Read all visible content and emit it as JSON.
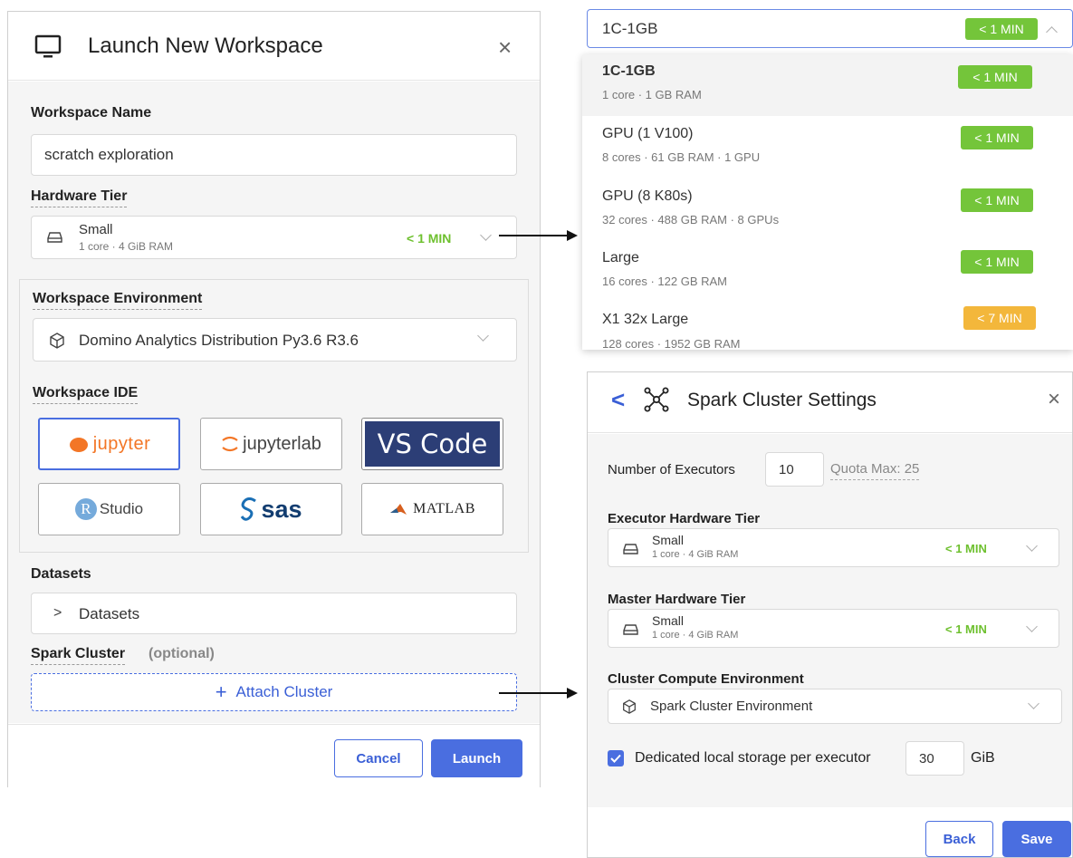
{
  "launch": {
    "title": "Launch New Workspace",
    "close": "×",
    "workspace_name_label": "Workspace Name",
    "workspace_name_value": "scratch exploration",
    "hardware_tier_label": "Hardware Tier",
    "hardware_tier": {
      "name": "Small",
      "spec": "1 core · 4 GiB RAM",
      "time": "< 1 MIN"
    },
    "env_label": "Workspace Environment",
    "env_value": "Domino Analytics Distribution Py3.6 R3.6",
    "ide_label": "Workspace IDE",
    "ides": [
      "jupyter",
      "jupyterlab",
      "VS Code",
      "Studio",
      "sas",
      "MATLAB"
    ],
    "ide_rstudio_r": "R",
    "ide_selected": "jupyter",
    "datasets_label": "Datasets",
    "datasets_toggle_glyph": ">",
    "datasets_toggle": "Datasets",
    "spark_label": "Spark Cluster",
    "spark_optional": "(optional)",
    "attach_plus": "+",
    "attach_cluster": "Attach Cluster",
    "cancel": "Cancel",
    "launch": "Launch"
  },
  "dropdown": {
    "selected": "1C-1GB",
    "selected_time": "< 1 MIN",
    "options": [
      {
        "name": "1C-1GB",
        "spec": "1 core · 1 GB RAM",
        "time": "< 1 MIN",
        "color": "#74c53a"
      },
      {
        "name": "GPU (1 V100)",
        "spec": "8 cores · 61 GB RAM · 1 GPU",
        "time": "< 1 MIN",
        "color": "#74c53a"
      },
      {
        "name": "GPU (8 K80s)",
        "spec": "32 cores · 488 GB RAM · 8 GPUs",
        "time": "< 1 MIN",
        "color": "#74c53a"
      },
      {
        "name": "Large",
        "spec": "16 cores · 122 GB RAM",
        "time": "< 1 MIN",
        "color": "#74c53a"
      },
      {
        "name": "X1 32x Large",
        "spec": "128 cores · 1952 GB RAM",
        "time": "< 7 MIN",
        "color": "#f3b73b"
      }
    ]
  },
  "spark": {
    "back_glyph": "<",
    "title": "Spark Cluster Settings",
    "close": "×",
    "executors_label": "Number of Executors",
    "executors_value": "10",
    "quota": "Quota Max: 25",
    "executor_tier_label": "Executor Hardware Tier",
    "executor_tier": {
      "name": "Small",
      "spec": "1 core · 4 GiB RAM",
      "time": "< 1 MIN"
    },
    "master_tier_label": "Master Hardware Tier",
    "master_tier": {
      "name": "Small",
      "spec": "1 core · 4 GiB RAM",
      "time": "< 1 MIN"
    },
    "compute_env_label": "Cluster Compute Environment",
    "compute_env_value": "Spark Cluster Environment",
    "storage_label": "Dedicated local storage per executor",
    "storage_checked": true,
    "storage_value": "30",
    "storage_unit": "GiB",
    "back": "Back",
    "save": "Save"
  },
  "colors": {
    "accent": "#4a6ee0",
    "green": "#74c53a",
    "orange": "#f3b73b"
  }
}
